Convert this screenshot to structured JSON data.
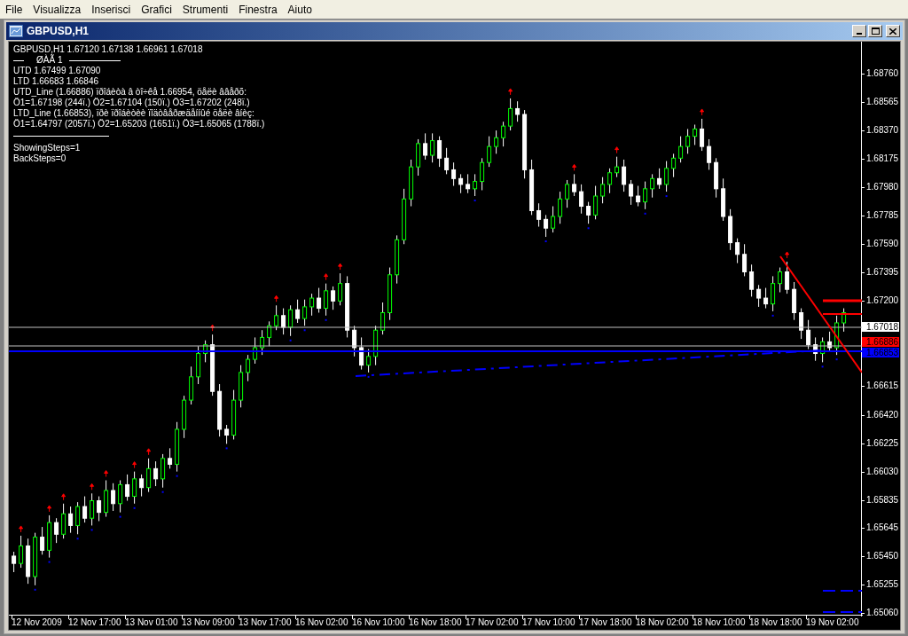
{
  "menu": [
    {
      "label": "File"
    },
    {
      "label": "Visualizza"
    },
    {
      "label": "Inserisci"
    },
    {
      "label": "Grafici"
    },
    {
      "label": "Strumenti"
    },
    {
      "label": "Finestra"
    },
    {
      "label": "Aiuto"
    }
  ],
  "window": {
    "title": "GBPUSD,H1"
  },
  "chart": {
    "info": {
      "header": "GBPUSD,H1  1.67120 1.67138 1.66961 1.67018",
      "step": "ØÀÃ 1",
      "lines": [
        "UTD 1.67499  1.67090",
        "LTD  1.66683  1.66846",
        "UTD_Line (1.66886) ïðîáèòà â òî÷êå 1.66954, öåëè ââåðõ:",
        "Ö1=1.67198 (244ï.) Ö2=1.67104 (150ï.) Ö3=1.67202 (248ï.)",
        "LTD_Line (1.66853), ïðè ïðîáèòèè ïîäòâåðæäåííûé öåëè âíèç:",
        "Ö1=1.64797 (2057ï.) Ö2=1.65203 (1651ï.) Ö3=1.65065 (1788ï.)"
      ],
      "settings": [
        "ShowingSteps=1",
        "BackSteps=0"
      ]
    },
    "price_badges": [
      {
        "text": "1.67018",
        "color": "#ffffff"
      },
      {
        "text": "1.66886",
        "color": "#ff0000"
      },
      {
        "text": "1.66853",
        "color": "#0000ff"
      }
    ],
    "time_axis": [
      "12 Nov 2009",
      "12 Nov 17:00",
      "13 Nov 01:00",
      "13 Nov 09:00",
      "13 Nov 17:00",
      "16 Nov 02:00",
      "16 Nov 10:00",
      "16 Nov 18:00",
      "17 Nov 02:00",
      "17 Nov 10:00",
      "17 Nov 18:00",
      "18 Nov 02:00",
      "18 Nov 10:00",
      "18 Nov 18:00",
      "19 Nov 02:00"
    ],
    "chart_data": {
      "type": "candlestick",
      "ylim": [
        1.65048,
        1.68979
      ],
      "yticks": [
        {
          "value": 1.6876,
          "label": "1.68760"
        },
        {
          "value": 1.68565,
          "label": "1.68565"
        },
        {
          "value": 1.6837,
          "label": "1.68370"
        },
        {
          "value": 1.68175,
          "label": "1.68175"
        },
        {
          "value": 1.6798,
          "label": "1.67980"
        },
        {
          "value": 1.67785,
          "label": "1.67785"
        },
        {
          "value": 1.6759,
          "label": "1.67590"
        },
        {
          "value": 1.67395,
          "label": "1.67395"
        },
        {
          "value": 1.672,
          "label": "1.67200"
        },
        {
          "value": 1.66615,
          "label": "1.66615"
        },
        {
          "value": 1.6642,
          "label": "1.66420"
        },
        {
          "value": 1.66225,
          "label": "1.66225"
        },
        {
          "value": 1.6603,
          "label": "1.66030"
        },
        {
          "value": 1.65835,
          "label": "1.65835"
        },
        {
          "value": 1.65645,
          "label": "1.65645"
        },
        {
          "value": 1.6545,
          "label": "1.65450"
        },
        {
          "value": 1.65255,
          "label": "1.65255"
        },
        {
          "value": 1.6506,
          "label": "1.65060"
        }
      ],
      "ohlc": [
        [
          1.6545,
          1.6548,
          1.6534,
          1.654
        ],
        [
          1.654,
          1.6559,
          1.6537,
          1.6552
        ],
        [
          1.6552,
          1.6557,
          1.6526,
          1.6531
        ],
        [
          1.6531,
          1.6561,
          1.6525,
          1.6558
        ],
        [
          1.6558,
          1.6565,
          1.6546,
          1.6549
        ],
        [
          1.6549,
          1.6573,
          1.6544,
          1.6568
        ],
        [
          1.6568,
          1.6571,
          1.6554,
          1.656
        ],
        [
          1.656,
          1.6581,
          1.6557,
          1.6574
        ],
        [
          1.6574,
          1.6579,
          1.6561,
          1.6566
        ],
        [
          1.6566,
          1.6582,
          1.656,
          1.6579
        ],
        [
          1.6579,
          1.6586,
          1.6568,
          1.6571
        ],
        [
          1.6571,
          1.6588,
          1.6566,
          1.6583
        ],
        [
          1.6583,
          1.6586,
          1.6569,
          1.6575
        ],
        [
          1.6575,
          1.6597,
          1.6572,
          1.659
        ],
        [
          1.659,
          1.6595,
          1.6576,
          1.6581
        ],
        [
          1.6581,
          1.6597,
          1.6575,
          1.6594
        ],
        [
          1.6594,
          1.6601,
          1.6583,
          1.6586
        ],
        [
          1.6586,
          1.6603,
          1.6581,
          1.6598
        ],
        [
          1.6598,
          1.6601,
          1.6586,
          1.6592
        ],
        [
          1.6592,
          1.6612,
          1.6589,
          1.6605
        ],
        [
          1.6605,
          1.661,
          1.6593,
          1.6598
        ],
        [
          1.6598,
          1.6615,
          1.6592,
          1.6612
        ],
        [
          1.6612,
          1.6619,
          1.6605,
          1.6608
        ],
        [
          1.6608,
          1.6637,
          1.6603,
          1.6632
        ],
        [
          1.6632,
          1.6655,
          1.6626,
          1.6652
        ],
        [
          1.6652,
          1.6675,
          1.6649,
          1.6668
        ],
        [
          1.6668,
          1.6689,
          1.6663,
          1.6684
        ],
        [
          1.6684,
          1.6693,
          1.6678,
          1.669
        ],
        [
          1.669,
          1.6697,
          1.6655,
          1.6658
        ],
        [
          1.6658,
          1.6663,
          1.6627,
          1.6632
        ],
        [
          1.6632,
          1.6635,
          1.6622,
          1.6628
        ],
        [
          1.6628,
          1.6659,
          1.6625,
          1.6652
        ],
        [
          1.6652,
          1.6676,
          1.6647,
          1.6671
        ],
        [
          1.6671,
          1.6683,
          1.6665,
          1.668
        ],
        [
          1.668,
          1.6695,
          1.6677,
          1.6688
        ],
        [
          1.6688,
          1.67,
          1.6683,
          1.6695
        ],
        [
          1.6695,
          1.6706,
          1.6689,
          1.6703
        ],
        [
          1.6703,
          1.6717,
          1.67,
          1.671
        ],
        [
          1.671,
          1.6715,
          1.6697,
          1.6702
        ],
        [
          1.6702,
          1.6717,
          1.6696,
          1.6714
        ],
        [
          1.6714,
          1.6721,
          1.6705,
          1.6708
        ],
        [
          1.6708,
          1.6721,
          1.6703,
          1.6716
        ],
        [
          1.6716,
          1.6725,
          1.671,
          1.6722
        ],
        [
          1.6722,
          1.6729,
          1.6712,
          1.6715
        ],
        [
          1.6715,
          1.6732,
          1.671,
          1.6727
        ],
        [
          1.6727,
          1.673,
          1.6714,
          1.672
        ],
        [
          1.672,
          1.6739,
          1.6717,
          1.6732
        ],
        [
          1.6732,
          1.6737,
          1.6695,
          1.67
        ],
        [
          1.67,
          1.6703,
          1.6682,
          1.6688
        ],
        [
          1.6688,
          1.6695,
          1.6673,
          1.6676
        ],
        [
          1.6676,
          1.6687,
          1.6671,
          1.6682
        ],
        [
          1.6682,
          1.6703,
          1.6676,
          1.67
        ],
        [
          1.67,
          1.6719,
          1.6697,
          1.6712
        ],
        [
          1.6712,
          1.6743,
          1.6707,
          1.6738
        ],
        [
          1.6738,
          1.6765,
          1.6732,
          1.6762
        ],
        [
          1.6762,
          1.6797,
          1.6759,
          1.679
        ],
        [
          1.679,
          1.6817,
          1.6785,
          1.6812
        ],
        [
          1.6812,
          1.6831,
          1.6806,
          1.6828
        ],
        [
          1.6828,
          1.6835,
          1.6817,
          1.682
        ],
        [
          1.682,
          1.6835,
          1.6815,
          1.683
        ],
        [
          1.683,
          1.6833,
          1.6812,
          1.6818
        ],
        [
          1.6818,
          1.6825,
          1.6807,
          1.681
        ],
        [
          1.681,
          1.6815,
          1.6799,
          1.6804
        ],
        [
          1.6804,
          1.6807,
          1.6794,
          1.68
        ],
        [
          1.68,
          1.6807,
          1.6794,
          1.6797
        ],
        [
          1.6797,
          1.6807,
          1.6792,
          1.6802
        ],
        [
          1.6802,
          1.6818,
          1.6796,
          1.6815
        ],
        [
          1.6815,
          1.6833,
          1.6812,
          1.6826
        ],
        [
          1.6826,
          1.6837,
          1.6821,
          1.6832
        ],
        [
          1.6832,
          1.6843,
          1.6826,
          1.684
        ],
        [
          1.684,
          1.6859,
          1.6837,
          1.6852
        ],
        [
          1.6852,
          1.6857,
          1.6843,
          1.6848
        ],
        [
          1.6848,
          1.6851,
          1.6804,
          1.681
        ],
        [
          1.681,
          1.6817,
          1.6779,
          1.6782
        ],
        [
          1.6782,
          1.6787,
          1.6771,
          1.6776
        ],
        [
          1.6776,
          1.6779,
          1.6764,
          1.677
        ],
        [
          1.677,
          1.6785,
          1.6767,
          1.6778
        ],
        [
          1.6778,
          1.6795,
          1.6773,
          1.679
        ],
        [
          1.679,
          1.6803,
          1.6784,
          1.68
        ],
        [
          1.68,
          1.6807,
          1.6792,
          1.6795
        ],
        [
          1.6795,
          1.68,
          1.678,
          1.6785
        ],
        [
          1.6785,
          1.6788,
          1.6773,
          1.6779
        ],
        [
          1.6779,
          1.6799,
          1.6776,
          1.6792
        ],
        [
          1.6792,
          1.6805,
          1.6787,
          1.68
        ],
        [
          1.68,
          1.6811,
          1.6794,
          1.6808
        ],
        [
          1.6808,
          1.6819,
          1.6805,
          1.6812
        ],
        [
          1.6812,
          1.6817,
          1.6795,
          1.68
        ],
        [
          1.68,
          1.6803,
          1.6786,
          1.6792
        ],
        [
          1.6792,
          1.6799,
          1.6785,
          1.6788
        ],
        [
          1.6788,
          1.6802,
          1.6783,
          1.6797
        ],
        [
          1.6797,
          1.6807,
          1.6791,
          1.6804
        ],
        [
          1.6804,
          1.6811,
          1.6797,
          1.68
        ],
        [
          1.68,
          1.6816,
          1.6795,
          1.6811
        ],
        [
          1.6811,
          1.6821,
          1.6805,
          1.6818
        ],
        [
          1.6818,
          1.6833,
          1.6815,
          1.6826
        ],
        [
          1.6826,
          1.6838,
          1.6821,
          1.6833
        ],
        [
          1.6833,
          1.6841,
          1.6827,
          1.6838
        ],
        [
          1.6838,
          1.6845,
          1.6823,
          1.6826
        ],
        [
          1.6826,
          1.6831,
          1.681,
          1.6815
        ],
        [
          1.6815,
          1.6818,
          1.6791,
          1.6797
        ],
        [
          1.6797,
          1.6804,
          1.6775,
          1.6778
        ],
        [
          1.6778,
          1.6783,
          1.6755,
          1.676
        ],
        [
          1.676,
          1.6763,
          1.6746,
          1.6752
        ],
        [
          1.6752,
          1.6759,
          1.6737,
          1.674
        ],
        [
          1.674,
          1.6745,
          1.6723,
          1.6728
        ],
        [
          1.6728,
          1.6731,
          1.6716,
          1.6722
        ],
        [
          1.6722,
          1.6729,
          1.6715,
          1.6718
        ],
        [
          1.6718,
          1.6737,
          1.6713,
          1.6732
        ],
        [
          1.6732,
          1.6743,
          1.6726,
          1.674
        ],
        [
          1.674,
          1.6747,
          1.6725,
          1.6728
        ],
        [
          1.6728,
          1.6733,
          1.6707,
          1.6712
        ],
        [
          1.6712,
          1.6715,
          1.6694,
          1.67
        ],
        [
          1.67,
          1.6707,
          1.6687,
          1.669
        ],
        [
          1.669,
          1.6695,
          1.6679,
          1.6684
        ],
        [
          1.6684,
          1.6695,
          1.6678,
          1.6692
        ],
        [
          1.6692,
          1.6699,
          1.6685,
          1.6688
        ],
        [
          1.6688,
          1.671,
          1.6683,
          1.6705
        ],
        [
          1.6705,
          1.6715,
          1.6699,
          1.6712
        ]
      ]
    }
  }
}
